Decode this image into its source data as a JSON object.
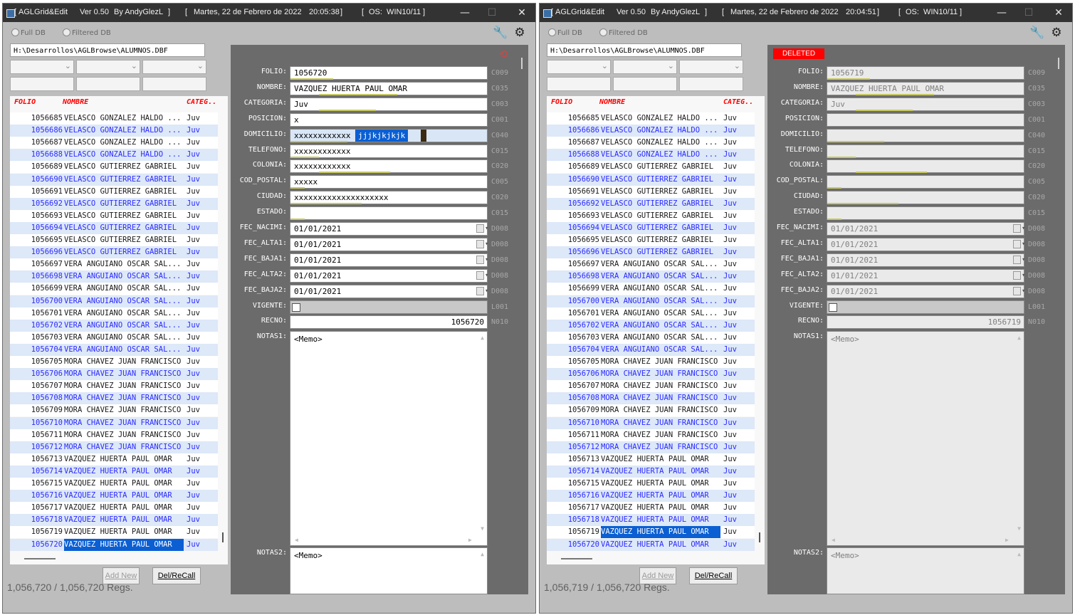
{
  "windows": [
    {
      "title": {
        "app": "AGLGrid&Edit",
        "version": "Ver 0.50",
        "author": "By AndyGlezL",
        "date": "Martes, 22 de Febrero de 2022",
        "time": "20:05:38",
        "os": "OS:  WIN10/11"
      },
      "radio_full": "Full DB",
      "radio_filtered": "Filtered DB",
      "path": "H:\\Desarrollos\\AGLBrowse\\ALUMNOS.DBF",
      "grid_headers": [
        "FOLIO",
        "NOMBRE",
        "CATEG.."
      ],
      "selected_row": 35,
      "buttons": {
        "add": "Add New",
        "del": "Del/ReCall"
      },
      "regs": "1,056,720 / 1,056,720  Regs.",
      "deleted_label": "",
      "fields": {
        "folio": "1056720",
        "nombre": "VAZQUEZ HUERTA PAUL OMAR",
        "categoria": "Juv",
        "posicion": "x",
        "domicilio": "xxxxxxxxxxxx",
        "domicilio_sel": "jjjkjkjkjk",
        "telefono": "xxxxxxxxxxxx",
        "colonia": "xxxxxxxxxxxx",
        "cod_postal": "xxxxx",
        "ciudad": "xxxxxxxxxxxxxxxxxxxx",
        "estado": "",
        "fec_nacimi": "01/01/2021",
        "fec_alta1": "01/01/2021",
        "fec_baja1": "01/01/2021",
        "fec_alta2": "01/01/2021",
        "fec_baja2": "01/01/2021",
        "recno": "1056720",
        "notas1": "<Memo>",
        "notas2": "<Memo>"
      }
    },
    {
      "title": {
        "app": "AGLGrid&Edit",
        "version": "Ver 0.50",
        "author": "By AndyGlezL",
        "date": "Martes, 22 de Febrero de 2022",
        "time": "20:04:51",
        "os": "OS:  WIN10/11"
      },
      "radio_full": "Full DB",
      "radio_filtered": "Filtered DB",
      "path": "H:\\Desarrollos\\AGLBrowse\\ALUMNOS.DBF",
      "grid_headers": [
        "FOLIO",
        "NOMBRE",
        "CATEG.."
      ],
      "selected_row": 34,
      "buttons": {
        "add": "Add New",
        "del": "Del/ReCall"
      },
      "regs": "1,056,719 / 1,056,720  Regs.",
      "deleted_label": "DELETED",
      "fields": {
        "folio": "1056719",
        "nombre": "VAZQUEZ HUERTA PAUL OMAR",
        "categoria": "Juv",
        "posicion": "",
        "domicilio": "",
        "domicilio_sel": "",
        "telefono": "",
        "colonia": "",
        "cod_postal": "",
        "ciudad": "",
        "estado": "",
        "fec_nacimi": "01/01/2021",
        "fec_alta1": "01/01/2021",
        "fec_baja1": "01/01/2021",
        "fec_alta2": "01/01/2021",
        "fec_baja2": "01/01/2021",
        "recno": "1056719",
        "notas1": "<Memo>",
        "notas2": "<Memo>"
      }
    }
  ],
  "field_labels": [
    "FOLIO:",
    "NOMBRE:",
    "CATEGORIA:",
    "POSICION:",
    "DOMICILIO:",
    "TELEFONO:",
    "COLONIA:",
    "COD_POSTAL:",
    "CIUDAD:",
    "ESTADO:",
    "FEC_NACIMI:",
    "FEC_ALTA1:",
    "FEC_BAJA1:",
    "FEC_ALTA2:",
    "FEC_BAJA2:",
    "VIGENTE:",
    "RECNO:",
    "NOTAS1:",
    "NOTAS2:"
  ],
  "field_codes": [
    "C009",
    "C035",
    "C003",
    "C001",
    "C040",
    "C015",
    "C020",
    "C005",
    "C020",
    "C015",
    "D008",
    "D008",
    "D008",
    "D008",
    "D008",
    "L001",
    "N010"
  ],
  "rows": [
    [
      "1056685",
      "VELASCO GONZALEZ HALDO ...",
      "Juv"
    ],
    [
      "1056686",
      "VELASCO GONZALEZ HALDO ...",
      "Juv"
    ],
    [
      "1056687",
      "VELASCO GONZALEZ HALDO ...",
      "Juv"
    ],
    [
      "1056688",
      "VELASCO GONZALEZ HALDO ...",
      "Juv"
    ],
    [
      "1056689",
      "VELASCO GUTIERREZ GABRIEL",
      "Juv"
    ],
    [
      "1056690",
      "VELASCO GUTIERREZ GABRIEL",
      "Juv"
    ],
    [
      "1056691",
      "VELASCO GUTIERREZ GABRIEL",
      "Juv"
    ],
    [
      "1056692",
      "VELASCO GUTIERREZ GABRIEL",
      "Juv"
    ],
    [
      "1056693",
      "VELASCO GUTIERREZ GABRIEL",
      "Juv"
    ],
    [
      "1056694",
      "VELASCO GUTIERREZ GABRIEL",
      "Juv"
    ],
    [
      "1056695",
      "VELASCO GUTIERREZ GABRIEL",
      "Juv"
    ],
    [
      "1056696",
      "VELASCO GUTIERREZ GABRIEL",
      "Juv"
    ],
    [
      "1056697",
      "VERA ANGUIANO OSCAR SAL...",
      "Juv"
    ],
    [
      "1056698",
      "VERA ANGUIANO OSCAR SAL...",
      "Juv"
    ],
    [
      "1056699",
      "VERA ANGUIANO OSCAR SAL...",
      "Juv"
    ],
    [
      "1056700",
      "VERA ANGUIANO OSCAR SAL...",
      "Juv"
    ],
    [
      "1056701",
      "VERA ANGUIANO OSCAR SAL...",
      "Juv"
    ],
    [
      "1056702",
      "VERA ANGUIANO OSCAR SAL...",
      "Juv"
    ],
    [
      "1056703",
      "VERA ANGUIANO OSCAR SAL...",
      "Juv"
    ],
    [
      "1056704",
      "VERA ANGUIANO OSCAR SAL...",
      "Juv"
    ],
    [
      "1056705",
      "MORA CHAVEZ JUAN FRANCISCO",
      "Juv"
    ],
    [
      "1056706",
      "MORA CHAVEZ JUAN FRANCISCO",
      "Juv"
    ],
    [
      "1056707",
      "MORA CHAVEZ JUAN FRANCISCO",
      "Juv"
    ],
    [
      "1056708",
      "MORA CHAVEZ JUAN FRANCISCO",
      "Juv"
    ],
    [
      "1056709",
      "MORA CHAVEZ JUAN FRANCISCO",
      "Juv"
    ],
    [
      "1056710",
      "MORA CHAVEZ JUAN FRANCISCO",
      "Juv"
    ],
    [
      "1056711",
      "MORA CHAVEZ JUAN FRANCISCO",
      "Juv"
    ],
    [
      "1056712",
      "MORA CHAVEZ JUAN FRANCISCO",
      "Juv"
    ],
    [
      "1056713",
      "VAZQUEZ HUERTA PAUL OMAR",
      "Juv"
    ],
    [
      "1056714",
      "VAZQUEZ HUERTA PAUL OMAR",
      "Juv"
    ],
    [
      "1056715",
      "VAZQUEZ HUERTA PAUL OMAR",
      "Juv"
    ],
    [
      "1056716",
      "VAZQUEZ HUERTA PAUL OMAR",
      "Juv"
    ],
    [
      "1056717",
      "VAZQUEZ HUERTA PAUL OMAR",
      "Juv"
    ],
    [
      "1056718",
      "VAZQUEZ HUERTA PAUL OMAR",
      "Juv"
    ],
    [
      "1056719",
      "VAZQUEZ HUERTA PAUL OMAR",
      "Juv"
    ],
    [
      "1056720",
      "VAZQUEZ HUERTA PAUL OMAR",
      "Juv"
    ]
  ],
  "colors": {
    "accent": "#0b5fd3",
    "deleted": "#ff0000",
    "row_alt_text": "#2b2bff",
    "header_text": "#ff0000"
  }
}
